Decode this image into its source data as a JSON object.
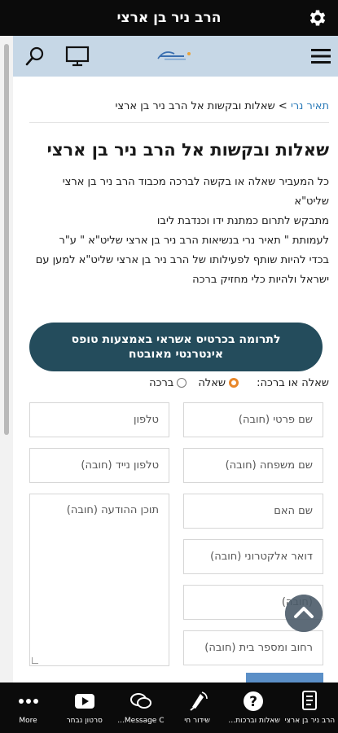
{
  "app": {
    "title": "הרב ניר בן ארצי"
  },
  "breadcrumb": {
    "link": "תאיר נרי",
    "separator": " > ",
    "current": "שאלות ובקשות אל הרב ניר בן ארצי"
  },
  "page": {
    "title": "שאלות ובקשות אל הרב ניר בן ארצי",
    "lines": [
      "כל המעביר שאלה או בקשה לברכה מכבוד הרב ניר בן ארצי שליט\"א",
      "מתבקש לתרום כמתנת ידו וכנדבת ליבו",
      "לעמותת \" תאיר נרי בנשיאות הרב ניר בן ארצי שליט\"א \" ע\"ר",
      "בכדי להיות שותף לפעילותו של הרב ניר בן ארצי שליט\"א למען עם ישראל ולהיות כלי מחזיק ברכה"
    ]
  },
  "donate": {
    "label": "לתרומה בכרטיס אשראי באמצעות טופס אינטרנטי מאובטח"
  },
  "question_type": {
    "label": "שאלה או ברכה:",
    "options": [
      {
        "label": "שאלה",
        "checked": true
      },
      {
        "label": "ברכה",
        "checked": false
      }
    ]
  },
  "form": {
    "first_name": "שם פרטי (חובה)",
    "last_name": "שם משפחה (חובה)",
    "mother_name": "שם האם",
    "email": "דואר אלקטרוני (חובה)",
    "city": "(חובה)",
    "street": "רחוב ומספר בית (חובה)",
    "phone": "טלפון",
    "mobile": "טלפון נייד (חובה)",
    "message": "תוכן ההודעה (חובה)"
  },
  "bottom_nav": [
    {
      "label": "הרב ניר בן ארצי",
      "icon": "document-icon"
    },
    {
      "label": "שאלות וברכות לרב",
      "icon": "question-icon"
    },
    {
      "label": "שידור חי",
      "icon": "broadcast-icon"
    },
    {
      "label": "Message C...",
      "icon": "chat-icon"
    },
    {
      "label": "סרטון נבחר",
      "icon": "video-icon"
    },
    {
      "label": "More",
      "icon": "more-icon"
    }
  ],
  "colors": {
    "accent": "#244c5c",
    "header_bg": "#c6d7e6",
    "link": "#2a7ab8",
    "radio_checked": "#e8872a",
    "bar_bg": "#0b0b0b"
  }
}
